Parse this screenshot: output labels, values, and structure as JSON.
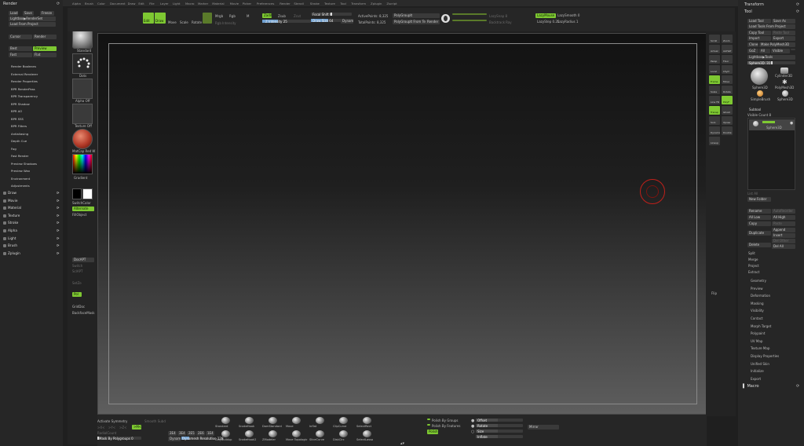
{
  "menu": [
    "Alpha",
    "Brush",
    "Color",
    "Document",
    "Draw",
    "Edit",
    "File",
    "Layer",
    "Light",
    "Macro",
    "Marker",
    "Material",
    "Movie",
    "Picker",
    "Preferences",
    "Render",
    "Stencil",
    "Stroke",
    "Texture",
    "Tool",
    "Transform",
    "Zplugin",
    "Zscript"
  ],
  "left_panel": {
    "title": "Render",
    "row1": [
      "Load",
      "Save",
      "Freeze"
    ],
    "row2": "Lightbox▶RenderSet",
    "row3": "Load From Project",
    "cursor": "Cursor",
    "render": "Render",
    "best": "Best",
    "preview": "Preview",
    "fast": "Fast",
    "flat": "Flat",
    "items": [
      "Render Booleans",
      "External Renderer",
      "Render Properties",
      "BPR RenderPass",
      "BPR Transparency",
      "BPR Shadow",
      "BPR AO",
      "BPR SSS",
      "BPR Filters",
      "Antialiasing",
      "Depth Cue",
      "Fog",
      "Fast Render",
      "Preview Shadows",
      "Preview Wax",
      "Environment",
      "Adjustments"
    ],
    "palettes": [
      "Draw",
      "Movie",
      "Material",
      "Texture",
      "Stroke",
      "Alpha",
      "Light",
      "Brush",
      "Zplugin"
    ]
  },
  "left_tools": {
    "use_brush": "Use Boolean",
    "standard": "Standard",
    "dots": "Dots",
    "alpha_off": "Alpha Off",
    "texture_off": "Texture Off",
    "material": "MatCap Red W",
    "gradient": "Gradient",
    "switch_color": "SwitchColor",
    "alternate": "Alternate",
    "fill_object": "FillObject",
    "dynamesh": "DocAPT",
    "switch": "Switch",
    "sculpt": "SclAPT",
    "symm": "SetZe",
    "pol": "Pol",
    "grid": "GridDoc",
    "backface": "BackfaceMask"
  },
  "top_shelf": {
    "edit": "Edit",
    "draw": "Draw",
    "move": "Move",
    "scale": "Scale",
    "rotate": "Rotate",
    "mrgb": "Mrgb",
    "rgb": "Rgb",
    "m": "M",
    "rgb_intensity": "Rgb Intensity",
    "zadd": "Zadd",
    "zsub": "Zsub",
    "zcut": "Zcut",
    "z_intensity": "Z Intensity 25",
    "focal_shift": "Focal Shift 0",
    "draw_size": "Draw Size 64",
    "dynamic": "Dynamic",
    "active_points": "ActivePoints: 8,325",
    "total_points": "TotalPoints: 8,325",
    "polygroups": "PolyGroupIt",
    "polygroup_from_tex": "PolyGroupIt From Tex",
    "render": "Render",
    "lazymouse": "LazyMouse",
    "lazysmooth": "LazySmooth 0",
    "lazystep": "LazyStep 0.25",
    "lazyradius": "LazyRadius 1",
    "lazy_snap": "LazySnap 8",
    "backtrack": "Backtrack Ray"
  },
  "right_tools": [
    "Scroll",
    "Zoom",
    "Actual",
    "AAHalf",
    "Persp",
    "Floor",
    "Local",
    "LSym",
    "Frame",
    "Move",
    "Scale",
    "Rotate",
    "Line Fill",
    "PolyF",
    "Transp",
    "Ghost",
    "Solo",
    "Xpose",
    "Dynamic",
    "Double",
    "Lineup",
    "Flip"
  ],
  "right_panel": {
    "transform": "Transform",
    "tool": "Tool",
    "load_tool": "Load Tool",
    "save_as": "Save As",
    "load_tools_from_project": "Load Tools From Project",
    "copy_tool": "Copy Tool",
    "paste_tool": "Paste Tool",
    "import": "Import",
    "export": "Export",
    "clone": "Clone",
    "make_polymesh": "Make PolyMesh3D",
    "goz": "GoZ",
    "all": "All",
    "visible": "Visible",
    "lightbox_tools": "Lightbox▶Tools",
    "sphere_label": "Sphere3D. 31",
    "thumbs": [
      "Sphere3D",
      "Cylinder3D",
      "SimpleBrush",
      "PolyMesh3D",
      "Sphere3D"
    ],
    "subtool": "Subtool",
    "visible_count": "Visible Count 8",
    "sub_sphere": "Sphere3D",
    "list_all": "List All",
    "new_folder": "New Folder",
    "rename": "Rename",
    "autoreorder": "AutoReorder",
    "all_low": "All Low",
    "all_high": "All High",
    "copy": "Copy",
    "paste": "Paste",
    "append": "Append",
    "duplicate": "Duplicate",
    "insert": "Insert",
    "delete": "Delete",
    "del_other": "Del Other",
    "del_all": "Del All",
    "split": "Split",
    "merge": "Merge",
    "project": "Project",
    "extract": "Extract",
    "sections": [
      "Geometry",
      "Preview",
      "Deformation",
      "Masking",
      "Visibility",
      "Contact",
      "Morph Target",
      "Polypaint",
      "UV Map",
      "Texture Map",
      "Display Properties",
      "Unified Skin",
      "Initialize",
      "Export"
    ],
    "macro": "Macro"
  },
  "bottom_shelf": {
    "activate_symmetry": "Activate Symmetry",
    "x": ">X<",
    "y": ">Y<",
    "z": ">Z<",
    "m": ">M<",
    "radial_count": "RadialCount",
    "mask_by_polygroups": "Mask By Polygroups 0",
    "smooth_subd": "Smooth Subd",
    "zr_labels": [
      "2E4",
      "3E4",
      "2E5",
      "2E6",
      "1E4"
    ],
    "dynamesh": "Dynamesh",
    "dynamesh_res": "Dynamesh Resolution 128",
    "brushes": [
      "Standard",
      "SnakeHook",
      "DamStandard",
      "Move",
      "Inflat",
      "ClipCurve",
      "SelectRect",
      "ClayBuildup",
      "SnakeHook2",
      "ZModeler",
      "Move Topologic",
      "SliceCurve",
      "DiskCirc",
      "SelectLasso"
    ],
    "polish_groups": "Polish By Groups",
    "polish_features": "Polish By Features",
    "polish": "Polish",
    "offset": "Offset",
    "rotate": "Rotate",
    "size": "Size",
    "inflate": "Inflate",
    "mirror": "Mirror"
  },
  "colors": {
    "accent_green": "#7ec832",
    "canvas_top": "#121212",
    "canvas_bottom": "#5e5e5e",
    "cursor_red": "#c0201a"
  }
}
